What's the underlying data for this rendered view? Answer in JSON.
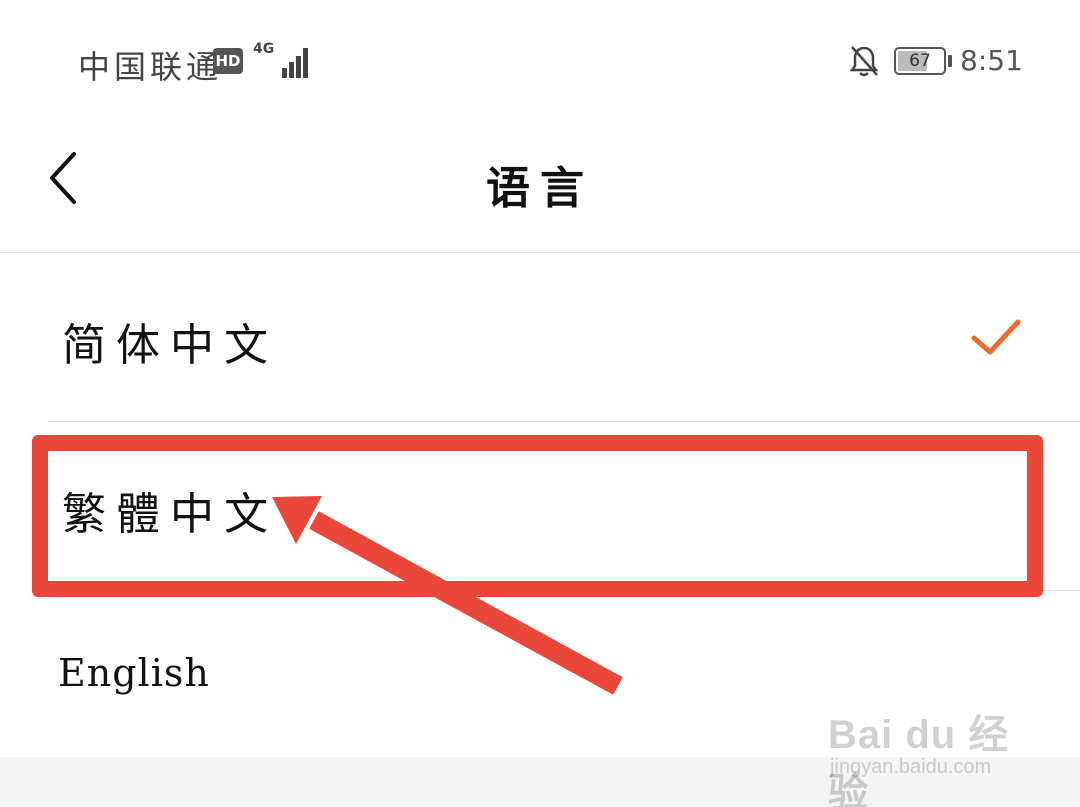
{
  "status_bar": {
    "carrier": "中国联通",
    "hd_badge": "HD",
    "network_type": "4G",
    "battery_level": "67",
    "time": "8:51",
    "icons": [
      "signal-icon",
      "bell-off-icon",
      "battery-icon"
    ]
  },
  "header": {
    "title": "语言",
    "back_icon": "chevron-left-icon"
  },
  "languages": [
    {
      "label": "简体中文",
      "selected": true
    },
    {
      "label": "繁體中文",
      "selected": false
    },
    {
      "label": "English",
      "selected": false
    }
  ],
  "annotation": {
    "color": "#e8473a",
    "highlighted_item": "繁體中文"
  },
  "accent_color": "#ee6a2a",
  "watermark": {
    "brand": "Bai du 经验",
    "url": "jingyan.baidu.com"
  }
}
